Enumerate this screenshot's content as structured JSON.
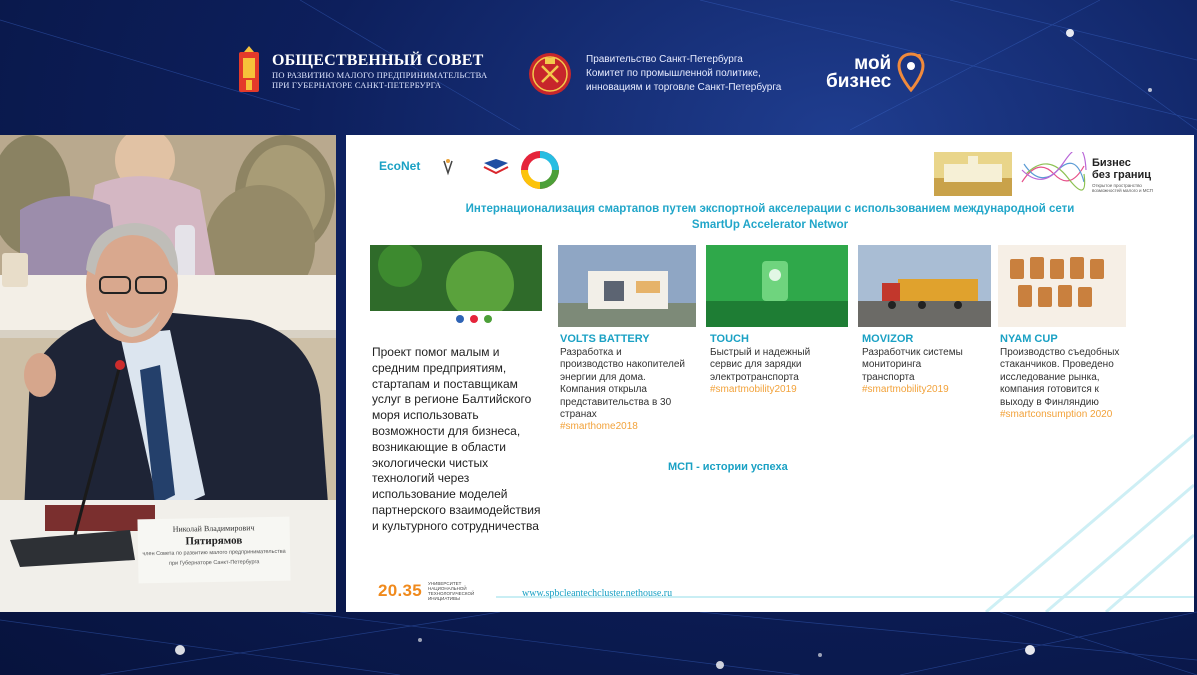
{
  "header": {
    "council": {
      "title": "ОБЩЕСТВЕННЫЙ СОВЕТ",
      "line2": "ПО РАЗВИТИЮ МАЛОГО ПРЕДПРИНИМАТЕЛЬСТВА",
      "line3": "ПРИ ГУБЕРНАТОРЕ САНКТ-ПЕТЕРБУРГА"
    },
    "government": {
      "line1": "Правительство Санкт-Петербурга",
      "line2": "Комитет по промышленной политике,",
      "line3": "инновациям и торговле Санкт-Петербурга"
    },
    "moi_biznes": {
      "word1": "мой",
      "word2": "бизнес"
    }
  },
  "camera": {
    "nameplate": {
      "first_names": "Николай Владимирович",
      "surname": "Пятирямов",
      "role_line1": "член Совета по развитию малого предпринимательства",
      "role_line2": "при Губернаторе Санкт-Петербурга"
    }
  },
  "slide": {
    "econet": "EcoNet",
    "business_without_borders": {
      "line1": "Бизнес",
      "line2": "без границ",
      "caption": "Открытое пространство возможностей малого и МСП"
    },
    "title_line1": "Интернационализация смартапов путем экспортной акселерации с использованием международной сети",
    "title_line2": "SmartUp Accelerator Networ",
    "project_text": "Проект помог малым и средним предприятиям, стартапам и поставщикам услуг в регионе Балтийского моря использовать возможности для бизнеса, возникающие в области экологически чистых технологий через использование моделей партнерского взаимодействия и культурного сотрудничества",
    "cards": [
      {
        "title": "VOLTS BATTERY",
        "desc": "Разработка и производство накопителей энергии для дома. Компания открыла представительства в 30 странах",
        "hashtag": "#smarthome2018"
      },
      {
        "title": "TOUCH",
        "desc": "Быстрый и надежный сервис для зарядки электротранспорта",
        "hashtag": "#smartmobility2019"
      },
      {
        "title": "MOVIZOR",
        "desc": "Разработчик системы мониторинга транспорта",
        "hashtag": "#smartmobility2019"
      },
      {
        "title": "NYAM CUP",
        "desc": "Производство съедобных стаканчиков. Проведено исследование рынка, компания готовится к выходу в Финляндию",
        "hashtag": "#smartconsumption 2020"
      }
    ],
    "msp_caption": "МСП - истории успеха",
    "brand_2035": {
      "number": "20.35",
      "caption": "УНИВЕРСИТЕТ НАЦИОНАЛЬНОЙ ТЕХНОЛОГИЧЕСКОЙ ИНИЦИАТИВЫ"
    },
    "url": "www.spbcleantechcluster.nethouse.ru"
  },
  "colors": {
    "background": "#0d1f5c",
    "slide_accent": "#1aa1c4",
    "hashtag": "#f2a23a",
    "brand_orange": "#f08a1c"
  }
}
